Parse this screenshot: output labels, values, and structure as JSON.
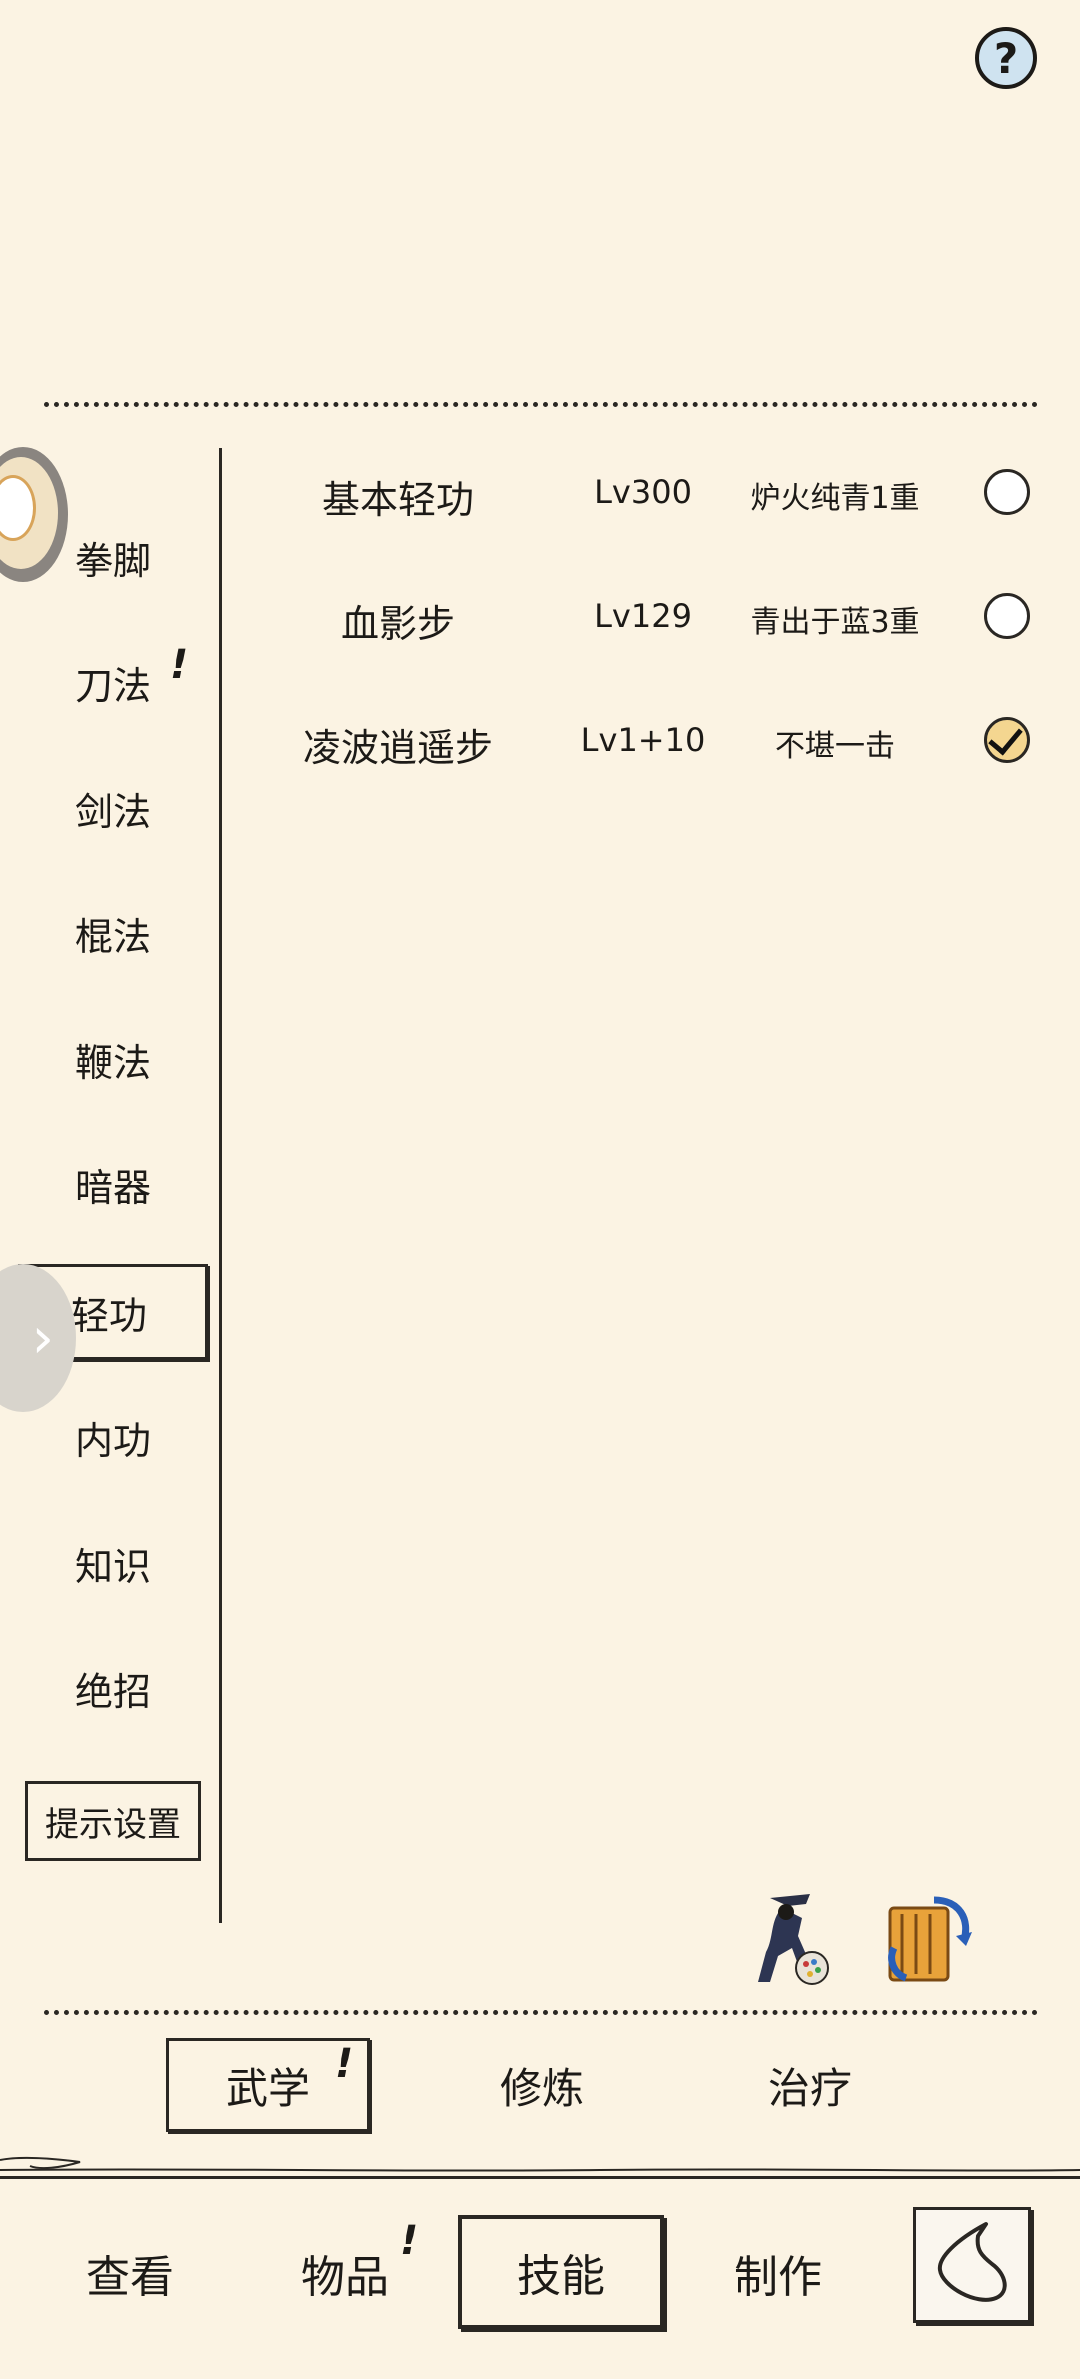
{
  "header": {
    "help_label": "?"
  },
  "sidebar": {
    "items": [
      {
        "label": "拳脚",
        "alert": ""
      },
      {
        "label": "刀法",
        "alert": "!"
      },
      {
        "label": "剑法",
        "alert": ""
      },
      {
        "label": "棍法",
        "alert": ""
      },
      {
        "label": "鞭法",
        "alert": ""
      },
      {
        "label": "暗器",
        "alert": ""
      },
      {
        "label": "轻功",
        "alert": ""
      },
      {
        "label": "内功",
        "alert": ""
      },
      {
        "label": "知识",
        "alert": ""
      },
      {
        "label": "绝招",
        "alert": ""
      }
    ],
    "active_index": 6,
    "hint_settings_label": "提示设置",
    "expand_arrow": "›"
  },
  "skills": [
    {
      "name": "基本轻功",
      "level": "Lv300",
      "tier": "炉火纯青1重",
      "selected": false
    },
    {
      "name": "血影步",
      "level": "Lv129",
      "tier": "青出于蓝3重",
      "selected": false
    },
    {
      "name": "凌波逍遥步",
      "level": "Lv1+10",
      "tier": "不堪一击",
      "selected": true
    }
  ],
  "action_icons": [
    "martial-figure-icon",
    "swap-scroll-icon"
  ],
  "subtabs": {
    "items": [
      "武学",
      "修炼",
      "治疗"
    ],
    "active_index": 0,
    "alert_on": "!"
  },
  "bottom_nav": {
    "items": [
      "查看",
      "物品",
      "技能",
      "制作"
    ],
    "active_index": 2,
    "item_alert": "!",
    "back_icon": "back-icon"
  },
  "colors": {
    "background": "#fbf3e3",
    "ink": "#2a2723",
    "checked_fill": "#f4d690",
    "help_fill": "#cfe3f0"
  }
}
